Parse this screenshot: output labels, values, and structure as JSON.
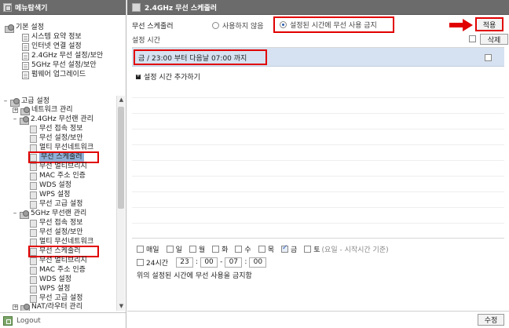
{
  "left_panel": {
    "title": "메뉴탐색기",
    "basic": {
      "label": "기본 설정",
      "items": [
        "시스템 요약 정보",
        "인터넷 연결 설정",
        "2.4GHz 무선 설정/보안",
        "5GHz 무선 설정/보안",
        "펌웨어 업그레이드"
      ]
    },
    "advanced": {
      "label": "고급 설정",
      "network": "네트워크 관리",
      "wlan24": {
        "label": "2.4GHz 무선랜 관리",
        "items": [
          "무선 접속 정보",
          "무선 설정/보안",
          "멀티 무선네트워크",
          "무선 스케줄러",
          "무선 멀티브리지",
          "MAC 주소 인증",
          "WDS 설정",
          "WPS 설정",
          "무선 고급 설정"
        ]
      },
      "wlan5": {
        "label": "5GHz 무선랜 관리",
        "items": [
          "무선 접속 정보",
          "무선 설정/보안",
          "멀티 무선네트워크",
          "무선 스케줄러",
          "무선 멀티브리지",
          "MAC 주소 인증",
          "WDS 설정",
          "WPS 설정",
          "무선 고급 설정"
        ]
      },
      "nat": "NAT/라우터 관리"
    },
    "logout": "Logout"
  },
  "right_panel": {
    "title": "2.4GHz 무선 스케줄러",
    "scheduler_label": "무선 스케줄러",
    "option_off": "사용하지 않음",
    "option_on": "설정된 시간에 무선 사용 금지",
    "apply": "적용",
    "list_header": "설정 시간",
    "delete": "삭제",
    "entry": "금 /  23:00 부터 다음날 07:00 까지",
    "add_time": "설정 시간 추가하기",
    "days": [
      {
        "label": "매일",
        "checked": false
      },
      {
        "label": "일",
        "checked": false
      },
      {
        "label": "월",
        "checked": false
      },
      {
        "label": "화",
        "checked": false
      },
      {
        "label": "수",
        "checked": false
      },
      {
        "label": "목",
        "checked": false
      },
      {
        "label": "금",
        "checked": true
      },
      {
        "label": "토",
        "checked": false
      }
    ],
    "day_note": "(요일 - 시작시간 기준)",
    "time_24h": "24시간",
    "start_hour": "23",
    "start_min": "00",
    "end_hour": "07",
    "end_min": "00",
    "description": "위의 설정된 시간에 무선 사용을 금지함",
    "edit": "수정"
  },
  "colors": {
    "header_bg": "#6b6b6b",
    "highlight_red": "#e10000",
    "selected_row": "#d6e2f1",
    "tree_selected": "#8fb1d9"
  }
}
